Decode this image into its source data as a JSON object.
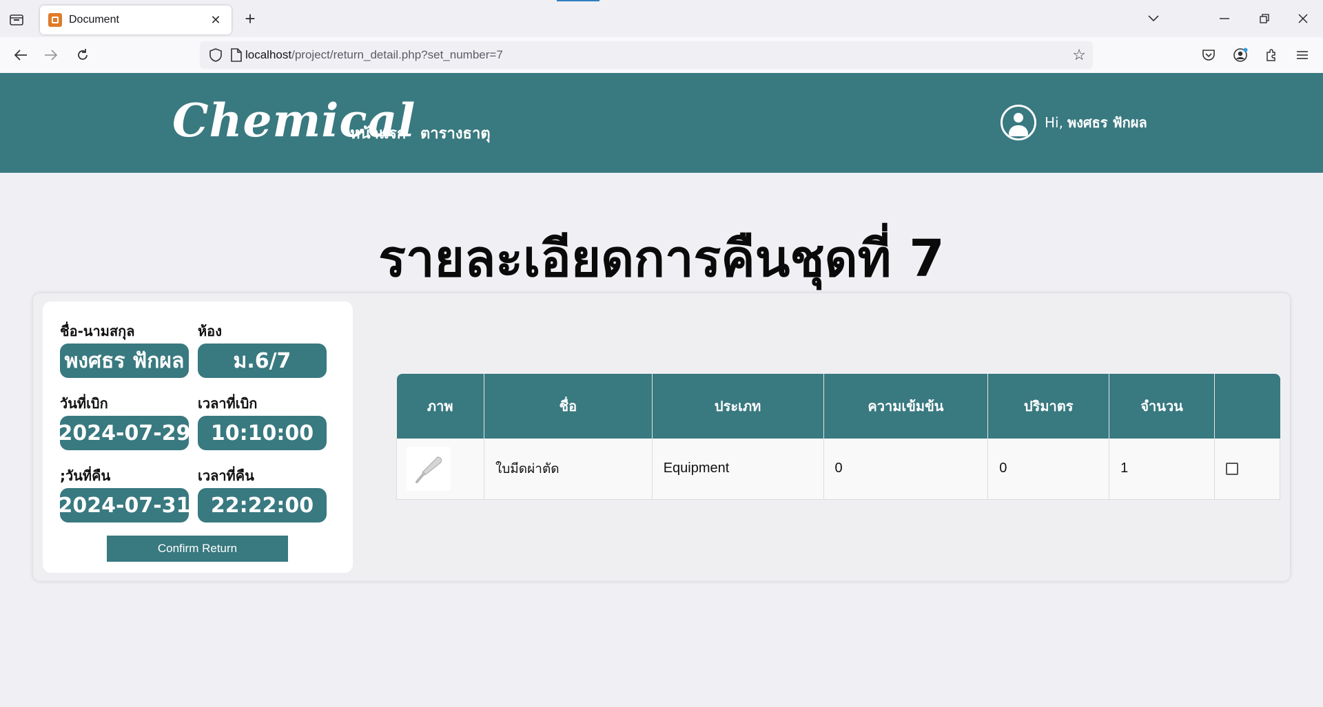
{
  "browser": {
    "tab_title": "Document",
    "url_host": "localhost",
    "url_path": "/project/return_detail.php?set_number=7"
  },
  "header": {
    "logo": "Chemical",
    "menu": [
      "หน้าแรก",
      "ตารางธาตุ"
    ],
    "greeting": "Hi,",
    "user_name": "พงศธร ฟักผล"
  },
  "page_title": "รายละเอียดการคืนชุดที่ 7",
  "info": {
    "name_label": "ชื่อ-นามสกุล",
    "name_value": "พงศธร ฟักผล",
    "room_label": "ห้อง",
    "room_value": "ม.6/7",
    "borrow_date_label": "วันที่เบิก",
    "borrow_date_value": "2024-07-29",
    "borrow_time_label": "เวลาที่เบิก",
    "borrow_time_value": "10:10:00",
    "return_date_label": ";วันที่คืน",
    "return_date_value": "2024-07-31",
    "return_time_label": "เวลาที่คืน",
    "return_time_value": "22:22:00",
    "confirm_label": "Confirm Return"
  },
  "table": {
    "headers": [
      "ภาพ",
      "ชื่อ",
      "ประเภท",
      "ความเข้มข้น",
      "ปริมาตร",
      "จำนวน",
      ""
    ],
    "rows": [
      {
        "image_icon": "scalpel-icon",
        "name": "ใบมีดผ่าตัด",
        "type": "Equipment",
        "concentration": "0",
        "volume": "0",
        "quantity": "1",
        "checked": false
      }
    ]
  },
  "colors": {
    "accent": "#397980",
    "page_bg": "#f0f0f4",
    "card_bg": "#efeff2"
  }
}
